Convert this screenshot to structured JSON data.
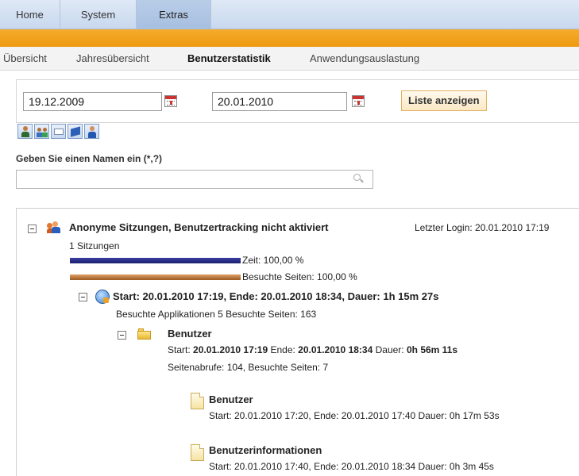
{
  "topnav": {
    "tabs": [
      {
        "label": "Home"
      },
      {
        "label": "System"
      },
      {
        "label": "Extras"
      }
    ]
  },
  "subnav": {
    "items": [
      {
        "label": "Übersicht"
      },
      {
        "label": "Jahresübersicht"
      },
      {
        "label": "Benutzerstatistik"
      },
      {
        "label": "Anwendungsauslastung"
      }
    ]
  },
  "filter": {
    "date_from": "19.12.2009",
    "date_to": "20.01.2010",
    "show_list_button": "Liste anzeigen"
  },
  "toolbar": {
    "icons": [
      "user-icon",
      "group-icon",
      "mail-icon",
      "book-icon",
      "person-icon"
    ]
  },
  "search": {
    "label": "Geben Sie einen Namen ein (*,?)",
    "value": ""
  },
  "tree": {
    "anon": {
      "title": "Anonyme Sitzungen, Benutzertracking nicht aktiviert",
      "last_login": "Letzter Login: 20.01.2010 17:19",
      "sessions": "1 Sitzungen",
      "time_label": "Zeit: 100,00 %",
      "pages_label": "Besuchte Seiten: 100,00 %",
      "time_pct": 100,
      "pages_pct": 100
    },
    "session": {
      "title": "Start: 20.01.2010 17:19, Ende: 20.01.2010 18:34, Dauer: 1h 15m 27s",
      "detail": "Besuchte Applikationen 5 Besuchte Seiten: 163"
    },
    "app": {
      "title": "Benutzer",
      "start_label": "Start:",
      "start": "20.01.2010 17:19",
      "end_label": "Ende:",
      "end": "20.01.2010 18:34",
      "duration_label": "Dauer:",
      "duration": "0h 56m 11s",
      "detail": "Seitenabrufe: 104, Besuchte Seiten: 7"
    },
    "pages": [
      {
        "title": "Benutzer",
        "detail": "Start: 20.01.2010 17:20, Ende: 20.01.2010 17:40 Dauer: 0h 17m 53s"
      },
      {
        "title": "Benutzerinformationen",
        "detail": "Start: 20.01.2010 17:40, Ende: 20.01.2010 18:34 Dauer: 0h 3m 45s"
      }
    ]
  }
}
